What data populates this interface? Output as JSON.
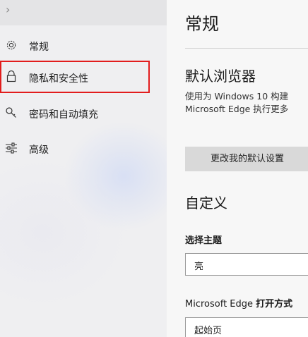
{
  "sidebar": {
    "back_glyph": "›",
    "items": [
      {
        "label": "常规",
        "icon": "gear-icon"
      },
      {
        "label": "隐私和安全性",
        "icon": "lock-icon"
      },
      {
        "label": "密码和自动填充",
        "icon": "key-icon"
      },
      {
        "label": "高级",
        "icon": "sliders-icon"
      }
    ],
    "selected_index": 1
  },
  "main": {
    "title": "常规",
    "default_browser": {
      "heading": "默认浏览器",
      "line1": "使用为 Windows 10 构建",
      "line2": "Microsoft Edge 执行更多",
      "button_label": "更改我的默认设置"
    },
    "customize": {
      "heading": "自定义",
      "theme_label": "选择主题",
      "theme_value": "亮",
      "open_with_label_prefix": "Microsoft Edge ",
      "open_with_label_bold": "打开方式",
      "open_with_value": "起始页"
    }
  },
  "colors": {
    "highlight_outline": "#e21d1d",
    "button_bg": "#d9d9d9"
  }
}
